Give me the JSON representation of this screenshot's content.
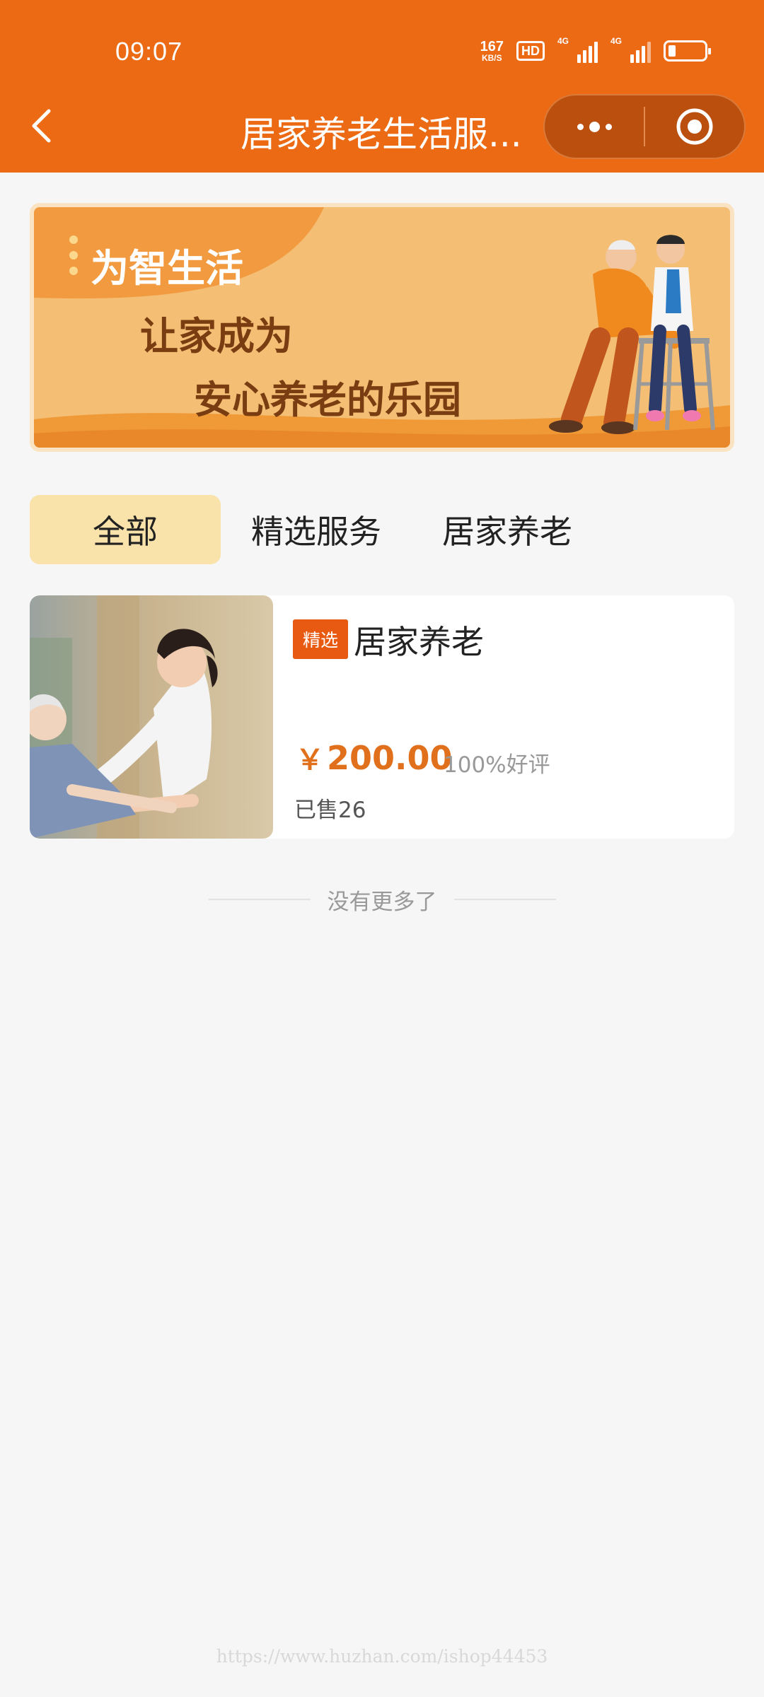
{
  "status_bar": {
    "time": "09:07",
    "net_speed_value": "167",
    "net_speed_unit": "KB/S",
    "hd_label": "HD",
    "signal1_label": "4G",
    "signal2_label": "4G"
  },
  "nav": {
    "title": "居家养老生活服..."
  },
  "banner": {
    "line1": "为智生活",
    "line2": "让家成为",
    "line3": "安心养老的乐园"
  },
  "tabs": [
    {
      "label": "全部",
      "active": true
    },
    {
      "label": "精选服务",
      "active": false
    },
    {
      "label": "居家养老",
      "active": false
    }
  ],
  "products": [
    {
      "tag": "精选",
      "title": "居家养老",
      "currency": "￥",
      "price": "200.00",
      "rating": "100%好评",
      "sold": "已售26"
    }
  ],
  "list_end_text": "没有更多了",
  "watermark": "https://www.huzhan.com/ishop44453",
  "colors": {
    "header_bg": "#ec6a14",
    "accent_price": "#e0701c",
    "active_tab_bg": "#f9e3aa",
    "tag_bg": "#e85a12"
  }
}
